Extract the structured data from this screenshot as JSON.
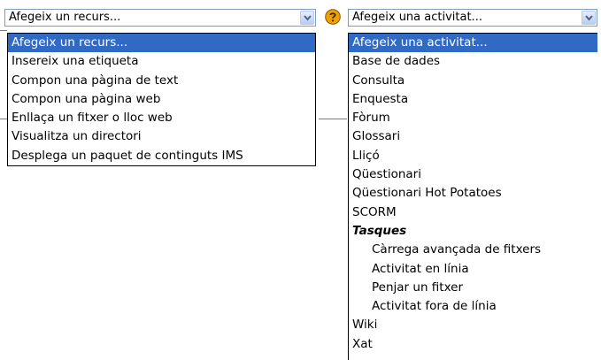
{
  "resource": {
    "selected": "Afegeix un recurs...",
    "options": [
      "Afegeix un recurs...",
      "Insereix una etiqueta",
      "Compon una pàgina de text",
      "Compon una pàgina web",
      "Enllaça un fitxer o lloc web",
      "Visualitza un directori",
      "Desplega un paquet de continguts IMS"
    ]
  },
  "activity": {
    "selected": "Afegeix una activitat...",
    "options": [
      "Afegeix una activitat...",
      "Base de dades",
      "Consulta",
      "Enquesta",
      "Fòrum",
      "Glossari",
      "Lliçó",
      "Qüestionari",
      "Qüestionari Hot Potatoes",
      "SCORM"
    ],
    "group_label": "Tasques",
    "group_options": [
      "Càrrega avançada de fitxers",
      "Activitat en línia",
      "Penjar un fitxer",
      "Activitat fora de línia"
    ],
    "tail_options": [
      "Wiki",
      "Xat"
    ]
  },
  "colors": {
    "highlight": "#316ac5",
    "help_icon": "#f0a000"
  },
  "icons": {
    "help": "question-mark-icon",
    "dropdown": "chevron-down-icon"
  }
}
